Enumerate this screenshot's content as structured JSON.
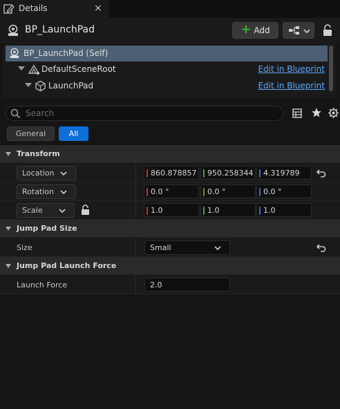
{
  "tab": {
    "label": "Details",
    "close": "×"
  },
  "header": {
    "title": "BP_LaunchPad",
    "add_label": "Add"
  },
  "components": {
    "items": [
      {
        "label": "BP_LaunchPad (Self)",
        "link": ""
      },
      {
        "label": "DefaultSceneRoot",
        "link": "Edit in Blueprint"
      },
      {
        "label": "LaunchPad",
        "link": "Edit in Blueprint"
      }
    ]
  },
  "search": {
    "placeholder": "Search"
  },
  "filters": {
    "general": "General",
    "all": "All"
  },
  "categories": {
    "transform": "Transform",
    "jump_pad_size": "Jump Pad Size",
    "jump_pad_launch_force": "Jump Pad Launch Force"
  },
  "transform": {
    "location": {
      "label": "Location",
      "x": "860.878857",
      "y": "950.258344",
      "z": "4.319789"
    },
    "rotation": {
      "label": "Rotation",
      "x": "0.0 °",
      "y": "0.0 °",
      "z": "0.0 °"
    },
    "scale": {
      "label": "Scale",
      "x": "1.0",
      "y": "1.0",
      "z": "1.0"
    }
  },
  "size": {
    "label": "Size",
    "value": "Small"
  },
  "launch_force": {
    "label": "Launch Force",
    "value": "2.0"
  },
  "colors": {
    "accent": "#0e6fd8",
    "selection": "#4d5f73",
    "link": "#5aa8ff",
    "axis_x": "#c8342c",
    "axis_y": "#5f9e23",
    "axis_z": "#2f6fd6",
    "add_plus": "#36b336"
  },
  "icons": [
    "pencil-icon",
    "close-icon",
    "actor-icon",
    "plus-icon",
    "blueprint-icon",
    "lock-icon",
    "scene-root-icon",
    "static-mesh-icon",
    "search-icon",
    "table-icon",
    "star-icon",
    "gear-icon",
    "chevron-down-icon",
    "reset-arrow-icon"
  ]
}
